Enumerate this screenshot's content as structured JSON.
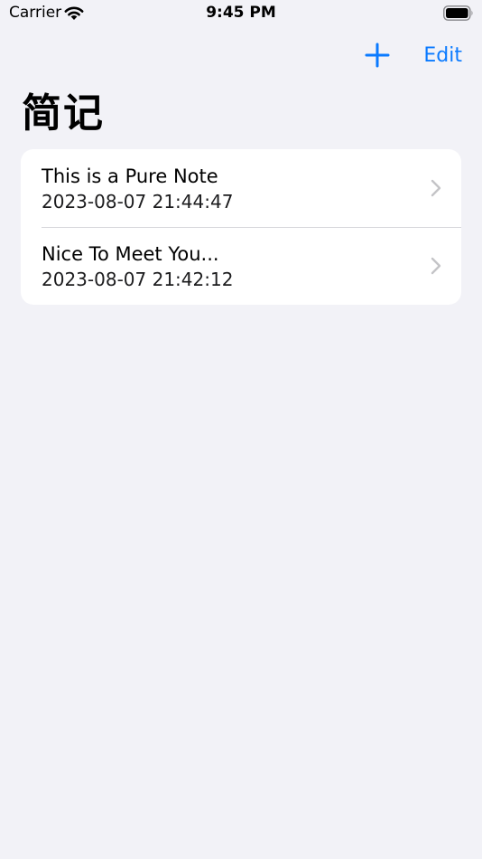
{
  "status_bar": {
    "carrier": "Carrier",
    "time": "9:45 PM",
    "icons": [
      "wifi-icon",
      "battery-icon"
    ]
  },
  "nav": {
    "add_icon": "plus-icon",
    "edit_label": "Edit",
    "accent_color": "#0a7aff"
  },
  "page": {
    "title": "简记"
  },
  "notes": [
    {
      "title": "This is a Pure Note",
      "date": "2023-08-07 21:44:47"
    },
    {
      "title": "Nice To Meet You...",
      "date": "2023-08-07 21:42:12"
    }
  ],
  "colors": {
    "background": "#f2f2f7",
    "card": "#ffffff",
    "chevron": "#c4c4c7"
  }
}
